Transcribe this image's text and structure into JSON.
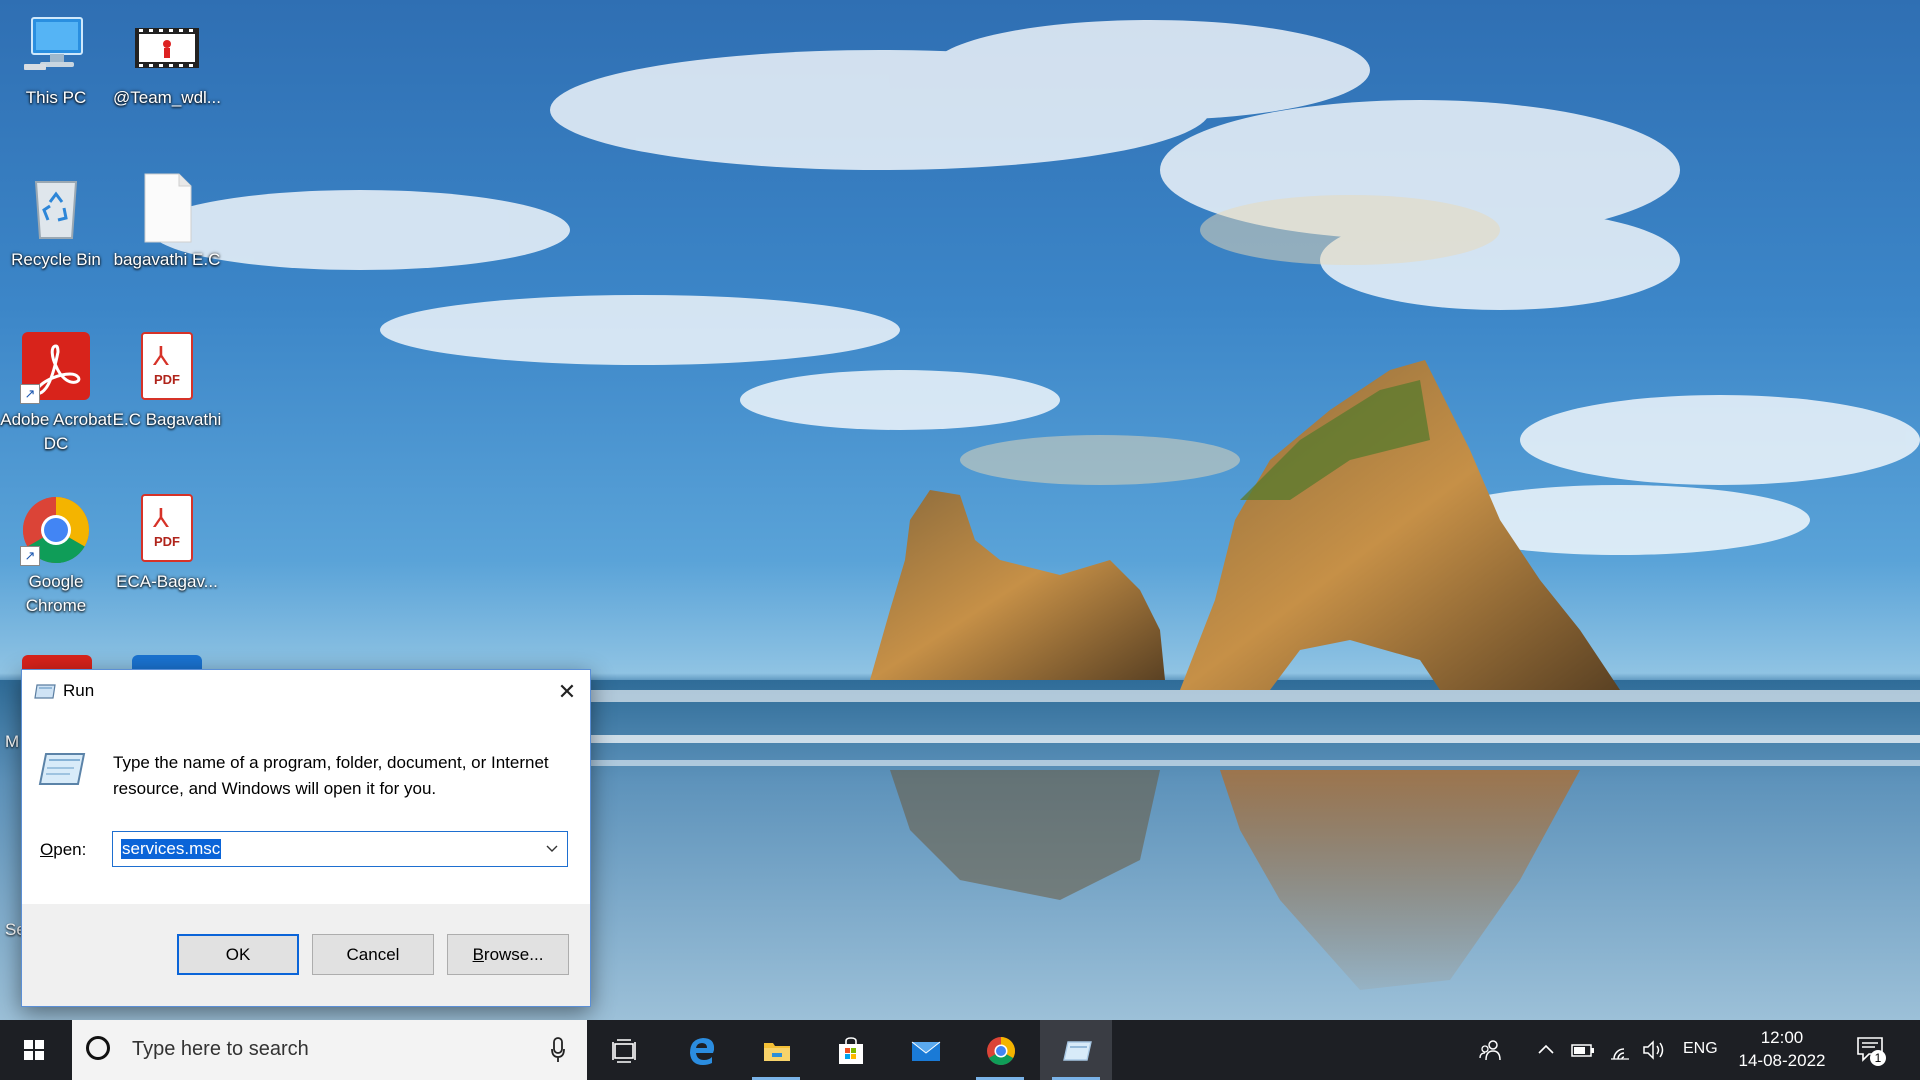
{
  "desktop": {
    "icons": [
      {
        "label": "This PC"
      },
      {
        "label": "@Team_wdl..."
      },
      {
        "label": "Recycle Bin"
      },
      {
        "label": "bagavathi E.C"
      },
      {
        "label": "Adobe Acrobat DC"
      },
      {
        "label": "E.C Bagavathi"
      },
      {
        "label": "Google Chrome"
      },
      {
        "label": "ECA-Bagav..."
      }
    ],
    "pdf_label": "PDF",
    "partial_labels": [
      "M",
      "Se"
    ]
  },
  "run_dialog": {
    "title": "Run",
    "description": "Type the name of a program, folder, document, or Internet resource, and Windows will open it for you.",
    "open_label_prefix": "",
    "open_label_accel": "O",
    "open_label_rest": "pen:",
    "open_value": "services.msc",
    "buttons": {
      "ok": "OK",
      "cancel": "Cancel",
      "browse_accel": "B",
      "browse_rest": "rowse..."
    },
    "close_glyph": "✕"
  },
  "taskbar": {
    "search_placeholder": "Type here to search",
    "apps": [
      {
        "name": "task-view-icon"
      },
      {
        "name": "edge-icon"
      },
      {
        "name": "file-explorer-icon"
      },
      {
        "name": "microsoft-store-icon"
      },
      {
        "name": "mail-icon"
      },
      {
        "name": "chrome-icon"
      },
      {
        "name": "run-icon"
      }
    ],
    "tray": {
      "language": "ENG",
      "time": "12:00",
      "date": "14-08-2022",
      "notification_count": "1"
    }
  },
  "colors": {
    "accent": "#0a64d8",
    "taskbar": "#1d1f24"
  }
}
